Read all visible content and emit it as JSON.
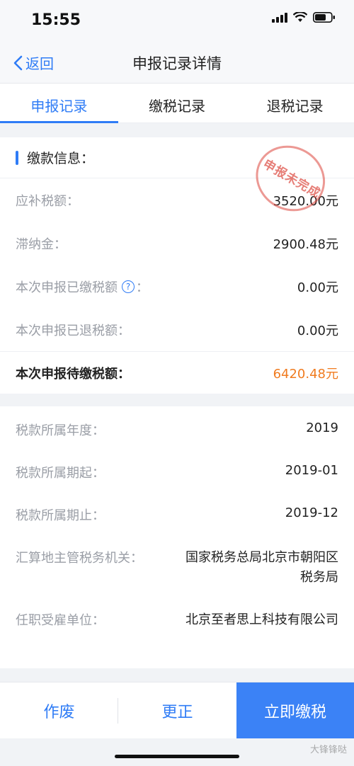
{
  "status": {
    "time": "15:55"
  },
  "nav": {
    "back_label": "返回",
    "title": "申报记录详情"
  },
  "tabs": [
    {
      "label": "申报记录",
      "active": true
    },
    {
      "label": "缴税记录",
      "active": false
    },
    {
      "label": "退税记录",
      "active": false
    }
  ],
  "payment": {
    "section_title": "缴款信息：",
    "stamp": "申报未完成",
    "rows": [
      {
        "label": "应补税额：",
        "value": "3520.00元"
      },
      {
        "label": "滞纳金：",
        "value": "2900.48元"
      },
      {
        "label": "本次申报已缴税额",
        "suffix": "：",
        "value": "0.00元"
      },
      {
        "label": "本次申报已退税额：",
        "value": "0.00元"
      }
    ],
    "total": {
      "label": "本次申报待缴税额：",
      "value": "6420.48元"
    }
  },
  "details": {
    "rows": [
      {
        "label": "税款所属年度：",
        "value": "2019"
      },
      {
        "label": "税款所属期起：",
        "value": "2019-01"
      },
      {
        "label": "税款所属期止：",
        "value": "2019-12"
      },
      {
        "label": "汇算地主管税务机关：",
        "value": "国家税务总局北京市朝阳区税务局"
      },
      {
        "label": "任职受雇单位：",
        "value": "北京至者思上科技有限公司"
      }
    ]
  },
  "bottom": {
    "void_label": "作废",
    "correct_label": "更正",
    "pay_label": "立即缴税"
  },
  "watermark": "大锋锋哒",
  "colors": {
    "accent": "#2f7cf6",
    "orange": "#f07b1f",
    "stamp": "#dc463c"
  }
}
